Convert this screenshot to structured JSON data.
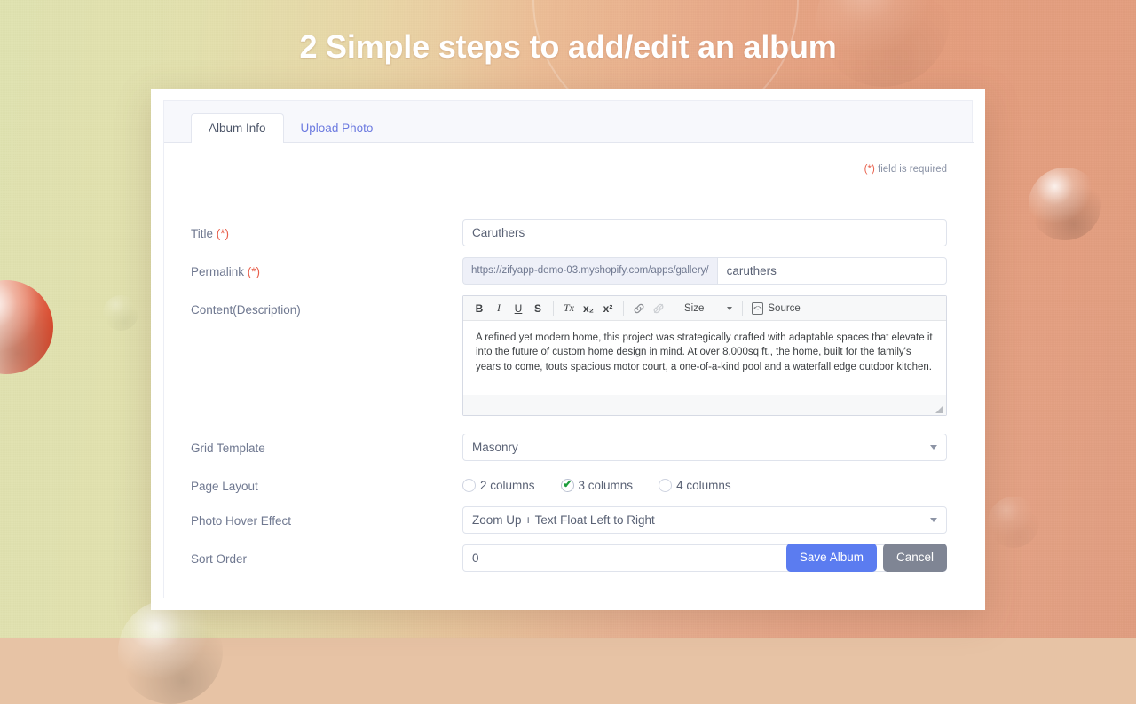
{
  "heading": "2 Simple steps to add/edit an album",
  "tabs": [
    {
      "label": "Album Info",
      "active": true
    },
    {
      "label": "Upload Photo",
      "active": false
    }
  ],
  "required_note": {
    "star": "(*)",
    "text": " field is required"
  },
  "form": {
    "title": {
      "label": "Title",
      "required_mark": "(*)",
      "value": "Caruthers",
      "placeholder": "Title"
    },
    "permalink": {
      "label": "Permalink",
      "required_mark": "(*)",
      "prefix": "https://zifyapp-demo-03.myshopify.com/apps/gallery/",
      "value": "caruthers",
      "placeholder": "permalink"
    },
    "content": {
      "label": "Content(Description)",
      "toolbar": {
        "bold": "B",
        "italic": "I",
        "underline": "U",
        "strike": "S",
        "remove_format": "Tx",
        "subscript": "x₂",
        "superscript": "x²",
        "link": "link-icon",
        "unlink": "unlink-icon",
        "size_label": "Size",
        "source_label": "Source"
      },
      "body": "A refined yet modern home, this project was strategically crafted with adaptable spaces that elevate it into the future of custom home design in mind. At over 8,000sq ft., the home, built for the family's years to come, touts spacious motor court, a one-of-a-kind pool and a waterfall edge outdoor kitchen."
    },
    "grid_template": {
      "label": "Grid Template",
      "value": "Masonry",
      "options": [
        "Masonry"
      ]
    },
    "page_layout": {
      "label": "Page Layout",
      "options": [
        {
          "label": "2 columns",
          "checked": false
        },
        {
          "label": "3 columns",
          "checked": true
        },
        {
          "label": "4 columns",
          "checked": false
        }
      ],
      "check_glyph": "✔"
    },
    "photo_hover_effect": {
      "label": "Photo Hover Effect",
      "value": "Zoom Up + Text Float Left to Right",
      "options": [
        "Zoom Up + Text Float Left to Right"
      ]
    },
    "sort_order": {
      "label": "Sort Order",
      "value": "0",
      "placeholder": "0"
    }
  },
  "actions": {
    "save": "Save Album",
    "cancel": "Cancel"
  },
  "colors": {
    "accent_blue": "#5b7cf0",
    "cancel_gray": "#7f8594",
    "required_red": "#e8604c",
    "check_green": "#1f9d3d",
    "tab_link": "#6c7ae0",
    "bg_left": "#dfe2b0",
    "bg_right": "#e09d80"
  }
}
